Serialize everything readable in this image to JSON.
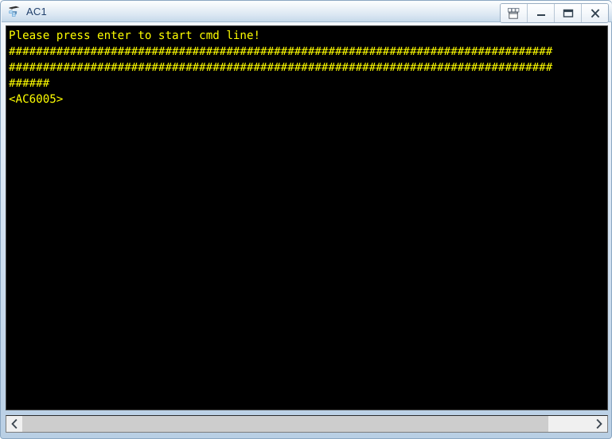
{
  "window": {
    "title": "AC1",
    "icon": "console-device-icon",
    "accent_color": "#1f3f6b",
    "frame_color": "#b9cfe4"
  },
  "window_controls": [
    {
      "name": "restore-windows-button",
      "icon": "cascade-windows-icon",
      "label": ""
    },
    {
      "name": "minimize-button",
      "icon": "minimize-icon",
      "label": "—"
    },
    {
      "name": "maximize-button",
      "icon": "maximize-icon",
      "label": ""
    },
    {
      "name": "close-button",
      "icon": "close-icon",
      "label": "X"
    }
  ],
  "terminal": {
    "background_color": "#000000",
    "text_color": "#ffff00",
    "lines": [
      "Please press enter to start cmd line!",
      "################################################################################",
      "################################################################################",
      "######",
      "<AC6005>"
    ],
    "line_1": "Please press enter to start cmd line!",
    "line_2": "################################################################################",
    "line_3": "################################################################################",
    "line_4": "######",
    "line_5": "<AC6005>",
    "prompt": "<AC6005>"
  },
  "scrollbar": {
    "orientation": "horizontal",
    "left_arrow": "‹",
    "right_arrow": "›",
    "thumb_percent": 92.5
  }
}
